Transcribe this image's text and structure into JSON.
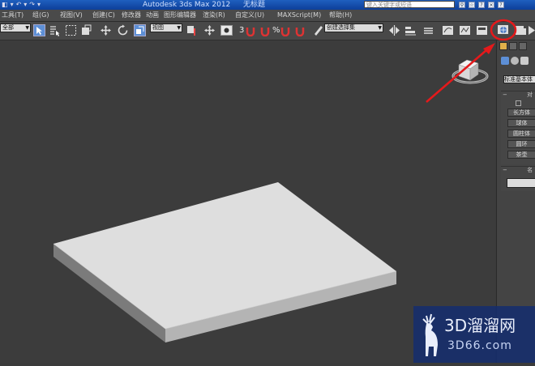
{
  "title_bar": {
    "quick_icons": [
      "◧",
      "▾",
      "↶",
      "▾",
      "↷",
      "▾"
    ],
    "app_title": "Autodesk 3ds Max  2012",
    "scene_name": "无标题",
    "search_placeholder": "键入关键字或短语",
    "right_icons": [
      "binoculars-icon",
      "star-icon",
      "help-icon",
      "x-icon",
      "help-icon"
    ]
  },
  "menu": {
    "items": [
      "工具(T)",
      "组(G)",
      "视图(V)",
      "创建(C)",
      "修改器",
      "动画",
      "图形编辑器",
      "渲染(R)",
      "自定义(U)",
      "MAXScript(M)",
      "帮助(H)"
    ]
  },
  "toolbar": {
    "selection_filter": "全部",
    "reference_coord": "视图",
    "named_selection": "创建选择集",
    "snap_label": "3",
    "percent_snap_label": "%"
  },
  "command_panel": {
    "category": "标准基本体",
    "rollout_object_type": "对",
    "autogrid_label": "",
    "object_buttons": [
      "长方体",
      "球体",
      "圆柱体",
      "圆环",
      "茶壶"
    ],
    "rollout_name": "名"
  },
  "annotation": {
    "color": "#e5191b"
  },
  "watermark": {
    "title": "3D溜溜网",
    "url": "3D66.com"
  },
  "colors": {
    "viewport_bg": "#3c3c3c",
    "box_top": "#dedede",
    "title_blue": "#1f5fbf"
  }
}
